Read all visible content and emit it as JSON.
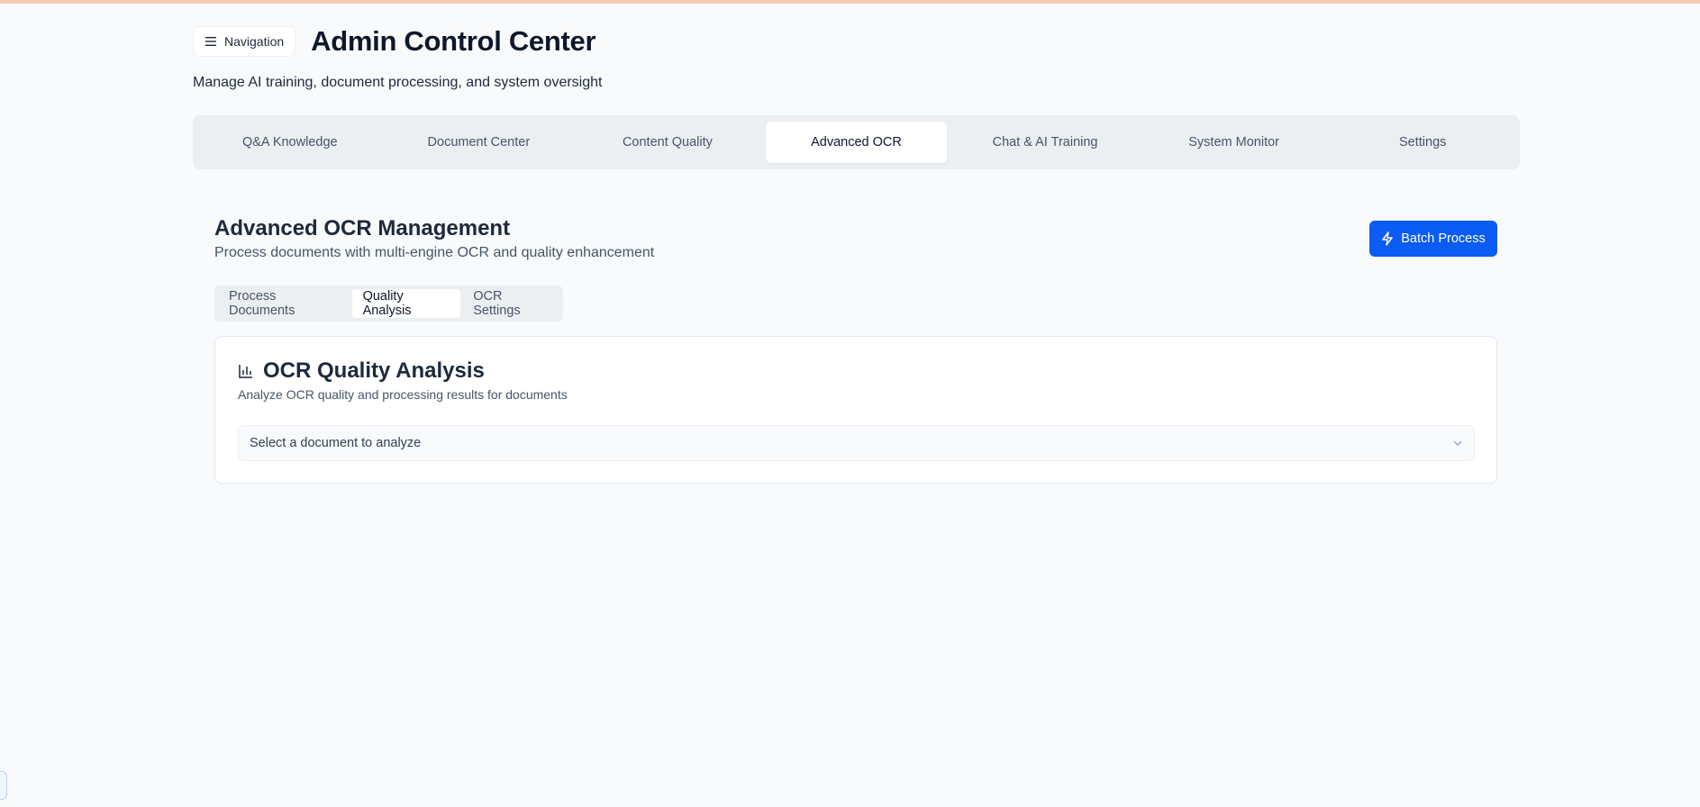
{
  "header": {
    "nav_button_label": "Navigation",
    "title": "Admin Control Center",
    "subtitle": "Manage AI training, document processing, and system oversight"
  },
  "main_tabs": [
    {
      "label": "Q&A Knowledge",
      "active": false
    },
    {
      "label": "Document Center",
      "active": false
    },
    {
      "label": "Content Quality",
      "active": false
    },
    {
      "label": "Advanced OCR",
      "active": true
    },
    {
      "label": "Chat & AI Training",
      "active": false
    },
    {
      "label": "System Monitor",
      "active": false
    },
    {
      "label": "Settings",
      "active": false
    }
  ],
  "section": {
    "title": "Advanced OCR Management",
    "description": "Process documents with multi-engine OCR and quality enhancement",
    "batch_button_label": "Batch Process"
  },
  "sub_tabs": [
    {
      "label": "Process Documents",
      "active": false
    },
    {
      "label": "Quality Analysis",
      "active": true
    },
    {
      "label": "OCR Settings",
      "active": false
    }
  ],
  "card": {
    "title": "OCR Quality Analysis",
    "description": "Analyze OCR quality and processing results for documents",
    "select_placeholder": "Select a document to analyze"
  },
  "icons": {
    "nav": "menu-icon",
    "batch": "bolt-icon",
    "card": "bar-chart-icon",
    "select": "chevron-down-icon"
  },
  "colors": {
    "accent": "#0a5cf5",
    "top_bar": "#f6cbb6",
    "background": "#f8fafc"
  }
}
